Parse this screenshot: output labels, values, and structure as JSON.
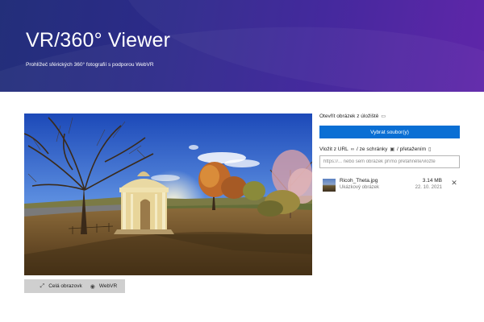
{
  "header": {
    "title": "VR/360° Viewer",
    "subtitle": "Prohlížeč sférických 360° fotografií s podporou WebVR"
  },
  "viewer": {
    "fullscreen_label": "Celá obrazovka",
    "webvr_label": "WebVR"
  },
  "panel": {
    "open_label": "Otevřít obrázek z úložiště",
    "choose_button": "Vybrat soubor(y)",
    "url_label": "Vložit z URL",
    "clipboard_label": "/ ze schránky",
    "drag_label": "/ přetažením",
    "url_placeholder": "https://... nebo sem obrázek přímo přetáhněte/vložte"
  },
  "files": [
    {
      "name": "Ricoh_Theta.jpg",
      "description": "Ukázkový obrázek",
      "size": "3.14 MB",
      "date": "22. 10. 2021"
    }
  ],
  "colors": {
    "primary_button": "#0a6fd4",
    "secondary_button": "#cfcfcf",
    "header_gradient_start": "#232f7a",
    "header_gradient_end": "#5a1fa6"
  },
  "icons": {
    "fullscreen": "expand-icon",
    "webvr": "eye-icon",
    "open": "folder-icon",
    "url": "link-icon",
    "clipboard": "clipboard-icon",
    "drag": "document-icon",
    "close": "close-icon"
  }
}
